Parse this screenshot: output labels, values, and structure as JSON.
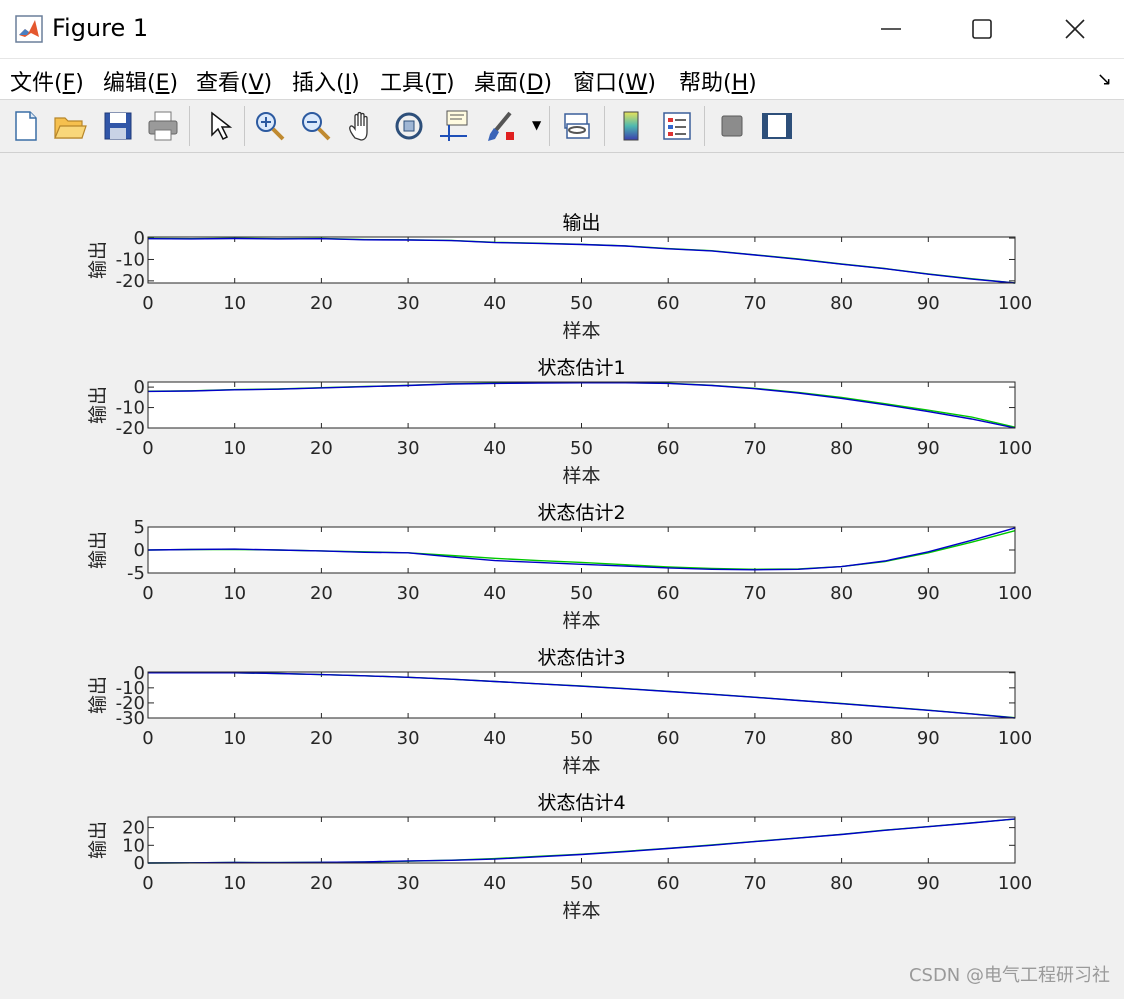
{
  "window": {
    "title": "Figure 1",
    "minimize_icon": "minimize-icon",
    "maximize_icon": "maximize-icon",
    "close_icon": "close-icon"
  },
  "menu": {
    "items": [
      {
        "text": "文件(",
        "key": "F",
        "close": ")"
      },
      {
        "text": "编辑(",
        "key": "E",
        "close": ")"
      },
      {
        "text": "查看(",
        "key": "V",
        "close": ")"
      },
      {
        "text": "插入(",
        "key": "I",
        "close": ")"
      },
      {
        "text": "工具(",
        "key": "T",
        "close": ")"
      },
      {
        "text": "桌面(",
        "key": "D",
        "close": ")"
      },
      {
        "text": "窗口(",
        "key": "W",
        "close": ")"
      },
      {
        "text": "帮助(",
        "key": "H",
        "close": ")"
      }
    ],
    "dock_icon": "dock-arrow-icon"
  },
  "toolbar": {
    "icons": [
      "new-figure-icon",
      "open-file-icon",
      "save-icon",
      "print-icon",
      "pointer-icon",
      "zoom-in-icon",
      "zoom-out-icon",
      "pan-hand-icon",
      "rotate-3d-icon",
      "data-cursor-icon",
      "brush-icon",
      "brush-dropdown-icon",
      "link-plot-icon",
      "colorbar-icon",
      "legend-icon",
      "hide-plot-tools-icon",
      "show-plot-tools-icon"
    ]
  },
  "colors": {
    "line_actual": "#00c800",
    "line_estimate": "#0000c8",
    "axes_bg": "#ffffff",
    "figure_bg": "#f0f0f0"
  },
  "chart_data": [
    {
      "type": "line",
      "title": "输出",
      "xlabel": "样本",
      "ylabel": "输出",
      "xlim": [
        0,
        100
      ],
      "ylim": [
        -21,
        0.5
      ],
      "xticks": [
        "0",
        "10",
        "20",
        "30",
        "40",
        "50",
        "60",
        "70",
        "80",
        "90",
        "100"
      ],
      "yticks": [
        "0",
        "-10",
        "-20"
      ],
      "ytick_values": [
        0,
        -10,
        -20
      ],
      "x": [
        0,
        5,
        10,
        15,
        20,
        25,
        30,
        35,
        40,
        45,
        50,
        55,
        60,
        65,
        70,
        75,
        80,
        85,
        90,
        95,
        100
      ],
      "series": [
        {
          "values": [
            -0.2,
            -0.3,
            -0.1,
            -0.3,
            -0.2,
            -0.7,
            -0.8,
            -1.1,
            -2.0,
            -2.4,
            -2.9,
            -3.6,
            -4.9,
            -5.9,
            -7.8,
            -9.8,
            -12.1,
            -14.2,
            -16.8,
            -19.0,
            -21.0
          ]
        },
        {
          "values": [
            -0.3,
            -0.4,
            -0.2,
            -0.4,
            -0.3,
            -0.8,
            -0.9,
            -1.2,
            -2.1,
            -2.5,
            -3.0,
            -3.7,
            -5.0,
            -6.0,
            -7.9,
            -9.9,
            -12.2,
            -14.3,
            -16.9,
            -19.2,
            -21.0
          ]
        }
      ]
    },
    {
      "type": "line",
      "title": "状态估计1",
      "xlabel": "样本",
      "ylabel": "输出",
      "xlim": [
        0,
        100
      ],
      "ylim": [
        -20,
        2.5
      ],
      "xticks": [
        "0",
        "10",
        "20",
        "30",
        "40",
        "50",
        "60",
        "70",
        "80",
        "90",
        "100"
      ],
      "yticks": [
        "0",
        "-10",
        "-20"
      ],
      "ytick_values": [
        0,
        -10,
        -20
      ],
      "x": [
        0,
        5,
        10,
        15,
        20,
        25,
        30,
        35,
        40,
        45,
        50,
        55,
        60,
        65,
        70,
        75,
        80,
        85,
        90,
        95,
        100
      ],
      "series": [
        {
          "values": [
            -2.0,
            -1.8,
            -1.2,
            -0.9,
            -0.3,
            0.3,
            0.9,
            1.6,
            1.9,
            2.1,
            2.2,
            2.2,
            1.9,
            0.9,
            -0.6,
            -2.6,
            -5.1,
            -8.1,
            -11.3,
            -14.6,
            -19.6
          ]
        },
        {
          "values": [
            -2.1,
            -1.9,
            -1.3,
            -1.0,
            -0.4,
            0.2,
            0.8,
            1.5,
            1.8,
            2.0,
            2.1,
            2.1,
            1.8,
            0.8,
            -0.8,
            -2.9,
            -5.5,
            -8.6,
            -12.0,
            -15.6,
            -20.0
          ]
        }
      ]
    },
    {
      "type": "line",
      "title": "状态估计2",
      "xlabel": "样本",
      "ylabel": "输出",
      "xlim": [
        0,
        100
      ],
      "ylim": [
        -5,
        5
      ],
      "xticks": [
        "0",
        "10",
        "20",
        "30",
        "40",
        "50",
        "60",
        "70",
        "80",
        "90",
        "100"
      ],
      "yticks": [
        "5",
        "0",
        "-5"
      ],
      "ytick_values": [
        5,
        0,
        -5
      ],
      "x": [
        0,
        5,
        10,
        15,
        20,
        25,
        30,
        35,
        40,
        45,
        50,
        55,
        60,
        65,
        70,
        75,
        80,
        85,
        90,
        95,
        100
      ],
      "series": [
        {
          "values": [
            0.0,
            0.1,
            0.1,
            0.0,
            -0.2,
            -0.4,
            -0.6,
            -1.2,
            -1.8,
            -2.3,
            -2.7,
            -3.2,
            -3.7,
            -4.0,
            -4.2,
            -4.1,
            -3.6,
            -2.5,
            -0.6,
            1.7,
            4.2
          ]
        },
        {
          "values": [
            0.0,
            0.1,
            0.2,
            0.0,
            -0.2,
            -0.5,
            -0.6,
            -1.5,
            -2.3,
            -2.7,
            -3.1,
            -3.5,
            -3.9,
            -4.2,
            -4.3,
            -4.2,
            -3.6,
            -2.4,
            -0.4,
            2.1,
            4.8
          ]
        }
      ]
    },
    {
      "type": "line",
      "title": "状态估计3",
      "xlabel": "样本",
      "ylabel": "输出",
      "xlim": [
        0,
        100
      ],
      "ylim": [
        -30,
        0.5
      ],
      "xticks": [
        "0",
        "10",
        "20",
        "30",
        "40",
        "50",
        "60",
        "70",
        "80",
        "90",
        "100"
      ],
      "yticks": [
        "0",
        "-10",
        "-20",
        "-30"
      ],
      "ytick_values": [
        0,
        -10,
        -20,
        -30
      ],
      "x": [
        0,
        5,
        10,
        15,
        20,
        25,
        30,
        35,
        40,
        45,
        50,
        55,
        60,
        65,
        70,
        75,
        80,
        85,
        90,
        95,
        100
      ],
      "series": [
        {
          "values": [
            0.0,
            0.0,
            0.0,
            -0.5,
            -1.2,
            -2.0,
            -3.0,
            -4.3,
            -5.8,
            -7.3,
            -8.8,
            -10.5,
            -12.3,
            -14.2,
            -16.2,
            -18.3,
            -20.4,
            -22.6,
            -24.8,
            -27.2,
            -29.8
          ]
        },
        {
          "values": [
            0.0,
            0.0,
            0.0,
            -0.5,
            -1.2,
            -2.0,
            -3.0,
            -4.3,
            -5.8,
            -7.3,
            -8.9,
            -10.6,
            -12.4,
            -14.3,
            -16.3,
            -18.4,
            -20.5,
            -22.7,
            -24.9,
            -27.3,
            -30.0
          ]
        }
      ]
    },
    {
      "type": "line",
      "title": "状态估计4",
      "xlabel": "样本",
      "ylabel": "输出",
      "xlim": [
        0,
        100
      ],
      "ylim": [
        0,
        26
      ],
      "xticks": [
        "0",
        "10",
        "20",
        "30",
        "40",
        "50",
        "60",
        "70",
        "80",
        "90",
        "100"
      ],
      "yticks": [
        "20",
        "10",
        "0"
      ],
      "ytick_values": [
        20,
        10,
        0
      ],
      "x": [
        0,
        5,
        10,
        15,
        20,
        25,
        30,
        35,
        40,
        45,
        50,
        55,
        60,
        65,
        70,
        75,
        80,
        85,
        90,
        95,
        100
      ],
      "series": [
        {
          "values": [
            0.0,
            0.1,
            0.3,
            0.2,
            0.4,
            0.6,
            1.0,
            1.6,
            2.5,
            3.8,
            5.0,
            6.6,
            8.3,
            10.2,
            12.2,
            14.2,
            16.2,
            18.6,
            20.6,
            22.7,
            24.8
          ]
        },
        {
          "values": [
            0.0,
            0.1,
            0.3,
            0.2,
            0.4,
            0.6,
            1.2,
            1.5,
            2.2,
            3.5,
            4.8,
            6.4,
            8.2,
            10.0,
            12.1,
            14.1,
            16.1,
            18.5,
            20.5,
            22.6,
            24.9
          ]
        }
      ]
    }
  ],
  "watermark": "CSDN @电气工程研习社"
}
